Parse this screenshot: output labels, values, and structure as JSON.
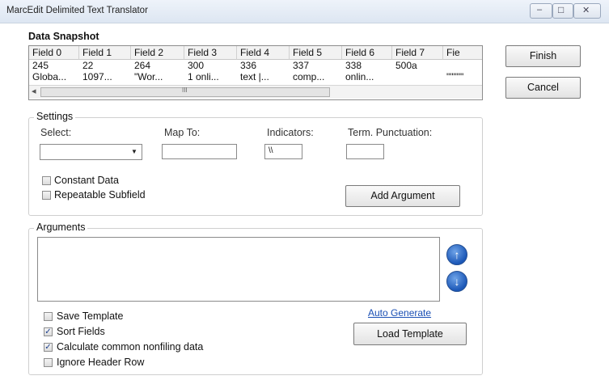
{
  "window": {
    "title": "MarcEdit Delimited Text Translator",
    "minimize_glyph": "–",
    "maximize_glyph": "□",
    "close_glyph": "✕"
  },
  "snapshot": {
    "title": "Data Snapshot",
    "headers": [
      "Field 0",
      "Field 1",
      "Field 2",
      "Field 3",
      "Field 4",
      "Field 5",
      "Field 6",
      "Field 7",
      "Fie"
    ],
    "rows": [
      [
        "245",
        "22",
        "264",
        "300",
        "336",
        "337",
        "338",
        "500a",
        ""
      ],
      [
        "Globa...",
        "1097...",
        "\"Wor...",
        "1 onli...",
        "text |...",
        "comp...",
        "onlin...",
        "",
        "\"\"\"\"\""
      ]
    ],
    "scroll_left": "◂",
    "scroll_right": "▸",
    "scroll_up": "▴",
    "scroll_down": "▾",
    "scroll_grip": "III"
  },
  "buttons": {
    "finish": "Finish",
    "cancel": "Cancel",
    "add_argument": "Add Argument",
    "load_template": "Load Template"
  },
  "settings": {
    "title": "Settings",
    "select_label": "Select:",
    "select_value": "",
    "dropdown_glyph": "▼",
    "map_to_label": "Map To:",
    "map_to_value": "",
    "indicators_label": "Indicators:",
    "indicators_value": "\\\\",
    "term_punct_label": "Term. Punctuation:",
    "term_punct_value": "",
    "constant_data": {
      "label": "Constant Data",
      "checked": false
    },
    "repeatable_subfield": {
      "label": "Repeatable Subfield",
      "checked": false
    }
  },
  "arguments": {
    "title": "Arguments",
    "up_glyph": "↑",
    "down_glyph": "↓",
    "auto_generate": "Auto Generate",
    "save_template": {
      "label": "Save Template",
      "checked": false
    },
    "sort_fields": {
      "label": "Sort Fields",
      "checked": true
    },
    "calc_nonfiling": {
      "label": "Calculate common nonfiling data",
      "checked": true
    },
    "ignore_header": {
      "label": "Ignore Header Row",
      "checked": false
    },
    "check_glyph": "✓"
  },
  "colors": {
    "accent": "#1b57b7",
    "link": "#1a4fb4"
  }
}
